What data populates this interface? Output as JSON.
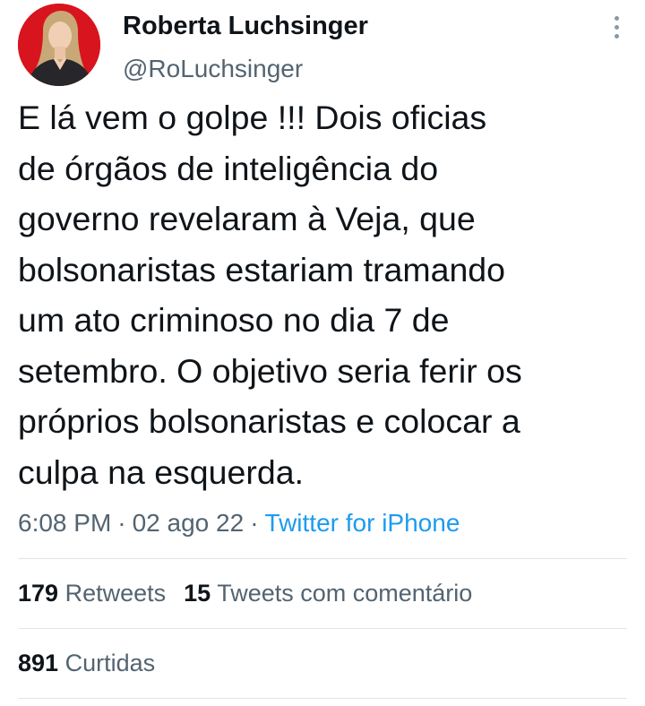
{
  "author": {
    "display_name": "Roberta Luchsinger",
    "handle": "@RoLuchsinger"
  },
  "tweet": {
    "text": "E lá vem o golpe !!! Dois oficias\nde órgãos de inteligência do\ngoverno revelaram à Veja, que\nbolsonaristas estariam tramando\num ato criminoso no dia 7 de\nsetembro. O objetivo seria ferir os\npróprios bolsonaristas e colocar a\nculpa na esquerda."
  },
  "meta": {
    "time": "6:08 PM",
    "separator": "·",
    "date": "02 ago 22",
    "source": "Twitter for iPhone"
  },
  "stats": {
    "retweets_count": "179",
    "retweets_label": "Retweets",
    "quotes_count": "15",
    "quotes_label": "Tweets com comentário",
    "likes_count": "891",
    "likes_label": "Curtidas"
  },
  "icons": {
    "more": "more-vertical-icon"
  },
  "colors": {
    "text": "#0f1419",
    "secondary": "#536471",
    "link": "#1d9bf0",
    "divider": "#e1e5e8",
    "avatar_bg": "#d8141f"
  }
}
